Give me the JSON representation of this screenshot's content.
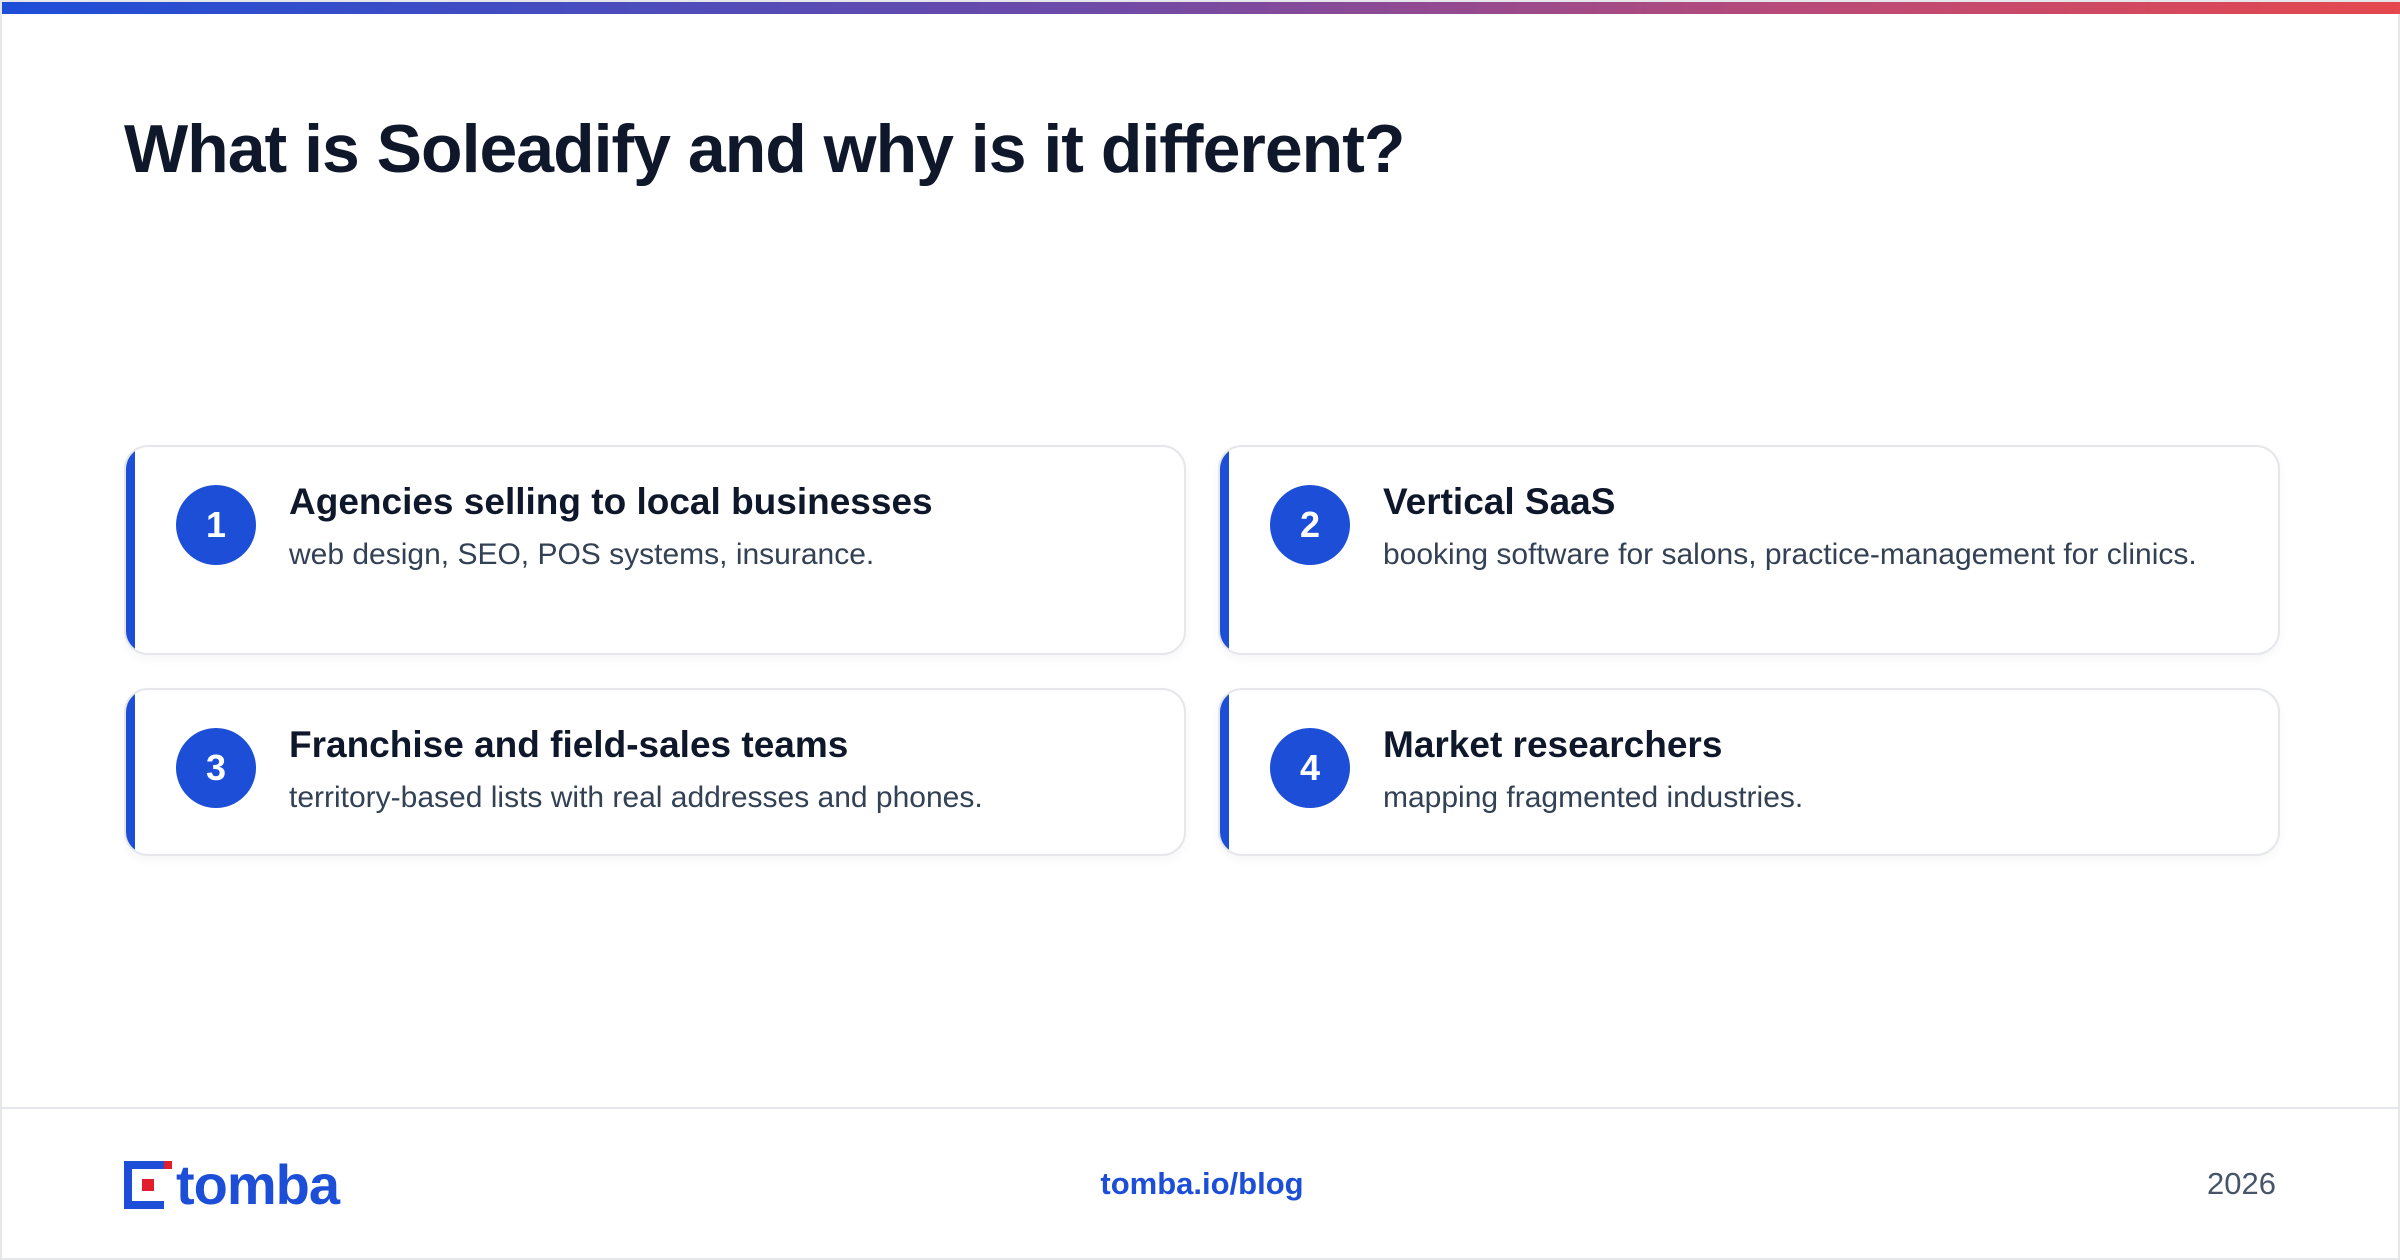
{
  "header": {
    "title": "What is Soleadify and why is it different?"
  },
  "cards": [
    {
      "number": "1",
      "title": "Agencies selling to local businesses",
      "description": "web design, SEO, POS systems, insurance."
    },
    {
      "number": "2",
      "title": "Vertical SaaS",
      "description": "booking software for salons, practice-management for clinics."
    },
    {
      "number": "3",
      "title": "Franchise and field-sales teams",
      "description": "territory-based lists with real addresses and phones."
    },
    {
      "number": "4",
      "title": "Market researchers",
      "description": "mapping fragmented industries."
    }
  ],
  "footer": {
    "logo_text": "tomba",
    "link": "tomba.io/blog",
    "year": "2026"
  },
  "colors": {
    "accent": "#1d4ed8",
    "logo_red": "#e11d2e",
    "gradient_end": "#e5484d"
  }
}
